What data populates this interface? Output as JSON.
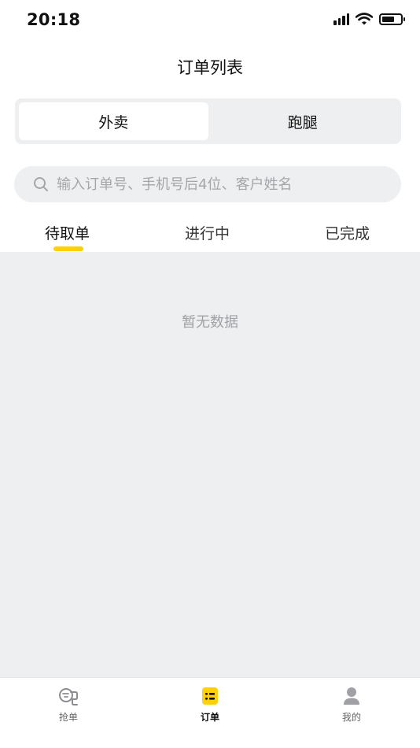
{
  "status_bar": {
    "time": "20:18",
    "battery_level": 0.7
  },
  "header": {
    "title": "订单列表"
  },
  "segment": {
    "items": [
      {
        "label": "外卖",
        "active": true
      },
      {
        "label": "跑腿",
        "active": false
      }
    ]
  },
  "search": {
    "placeholder": "输入订单号、手机号后4位、客户姓名",
    "value": ""
  },
  "tabs": [
    {
      "label": "待取单",
      "active": true
    },
    {
      "label": "进行中",
      "active": false
    },
    {
      "label": "已完成",
      "active": false
    }
  ],
  "content": {
    "empty_text": "暂无数据"
  },
  "bottom_nav": {
    "items": [
      {
        "label": "抢单"
      },
      {
        "label": "订单",
        "active": true
      },
      {
        "label": "我的"
      }
    ]
  },
  "colors": {
    "accent": "#ffd100",
    "background_gray": "#eeeff1",
    "placeholder": "#a4a6aa"
  },
  "icons": [
    "signal-icon",
    "wifi-icon",
    "battery-icon",
    "search-icon",
    "grab-order-icon",
    "order-icon",
    "profile-icon"
  ]
}
